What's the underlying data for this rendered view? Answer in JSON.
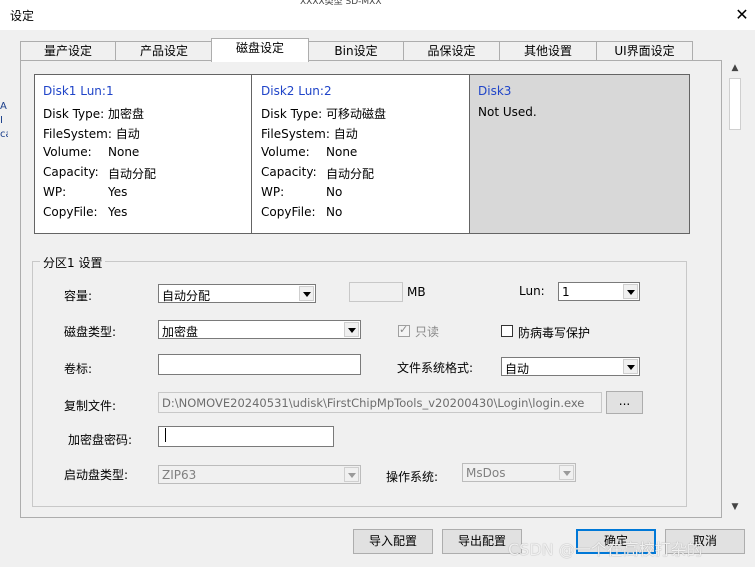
{
  "window": {
    "title": "设定",
    "bg_peek": "XXXX类型 SD-MXX"
  },
  "tabs": [
    "量产设定",
    "产品设定",
    "磁盘设定",
    "Bin设定",
    "品保设定",
    "其他设置",
    "UI界面设定"
  ],
  "active_tab": "磁盘设定",
  "left_strip": [
    "A",
    "I",
    "ca"
  ],
  "disks": [
    {
      "header": "Disk1    Lun:1",
      "lines": [
        {
          "k": "Disk Type:",
          "v": "加密盘"
        },
        {
          "k": "FileSystem:",
          "v": "自动"
        },
        {
          "k": "Volume:",
          "v": "None"
        },
        {
          "k": "Capacity:",
          "v": "自动分配"
        },
        {
          "k": "WP:",
          "v": "Yes"
        },
        {
          "k": "CopyFile:",
          "v": "Yes"
        }
      ]
    },
    {
      "header": "Disk2    Lun:2",
      "lines": [
        {
          "k": "Disk Type:",
          "v": "可移动磁盘"
        },
        {
          "k": "FileSystem:",
          "v": "自动"
        },
        {
          "k": "Volume:",
          "v": "None"
        },
        {
          "k": "Capacity:",
          "v": "自动分配"
        },
        {
          "k": "WP:",
          "v": "No"
        },
        {
          "k": "CopyFile:",
          "v": "No"
        }
      ]
    },
    {
      "header": "Disk3",
      "lines": [
        {
          "k": "Not Used.",
          "v": ""
        }
      ]
    }
  ],
  "partition": {
    "title": "分区1 设置",
    "capacity_label": "容量:",
    "capacity_value": "自动分配",
    "mb_value": "",
    "mb_label": "MB",
    "lun_label": "Lun:",
    "lun_value": "1",
    "disk_type_label": "磁盘类型:",
    "disk_type_value": "加密盘",
    "readonly_label": "只读",
    "readonly_checked": true,
    "antivirus_label": "防病毒写保护",
    "antivirus_checked": false,
    "volume_label": "卷标:",
    "volume_value": "",
    "fs_label": "文件系统格式:",
    "fs_value": "自动",
    "copy_label": "复制文件:",
    "copy_value": "D:\\NOMOVE20240531\\udisk\\FirstChipMpTools_v20200430\\Login\\login.exe",
    "browse_label": "...",
    "password_label": "加密盘密码:",
    "password_value": "",
    "boot_label": "启动盘类型:",
    "boot_value": "ZIP63",
    "os_label": "操作系统:",
    "os_value": "MsDos"
  },
  "buttons": {
    "import": "导入配置",
    "export": "导出配置",
    "ok": "确定",
    "cancel": "取消"
  },
  "watermark": "CSDN @一个在高校打杂的"
}
